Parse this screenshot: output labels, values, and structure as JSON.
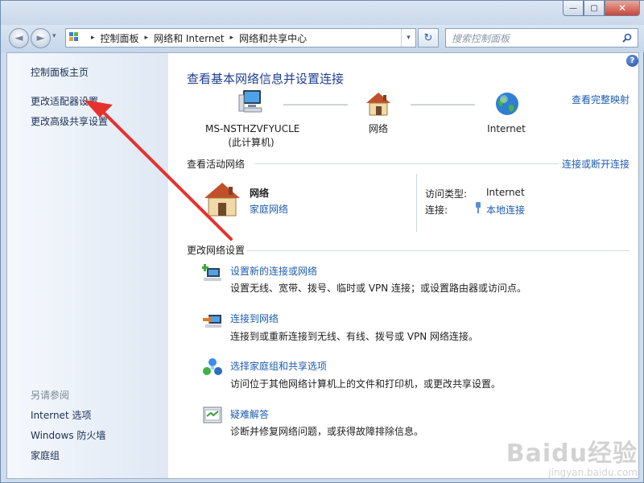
{
  "window": {
    "caption": {
      "minimize": "—",
      "maximize": "▢",
      "close": "✕"
    }
  },
  "navbar": {
    "back_glyph": "◄",
    "forward_glyph": "►",
    "address": {
      "segments": [
        "控制面板",
        "网络和 Internet",
        "网络和共享中心"
      ],
      "separator": "▸",
      "dropdown_glyph": "▾"
    },
    "refresh_glyph": "↻",
    "search_placeholder": "搜索控制面板"
  },
  "sidebar": {
    "links": [
      "控制面板主页",
      "更改适配器设置",
      "更改高级共享设置"
    ],
    "see_also_heading": "另请参阅",
    "see_also": [
      "Internet 选项",
      "Windows 防火墙",
      "家庭组"
    ]
  },
  "main": {
    "help_glyph": "?",
    "title": "查看基本网络信息并设置连接",
    "full_map_link": "查看完整映射",
    "map": {
      "computer_name": "MS-NSTHZVFYUCLE",
      "computer_sub": "(此计算机)",
      "network_label": "网络",
      "internet_label": "Internet"
    },
    "active": {
      "heading": "查看活动网络",
      "connect_link": "连接或断开连接",
      "network_name": "网络",
      "network_type": "家庭网络",
      "access_type_label": "访问类型:",
      "access_type_value": "Internet",
      "connections_label": "连接:",
      "connections_value": "本地连接"
    },
    "change": {
      "heading": "更改网络设置",
      "tasks": [
        {
          "icon": "new-connection-icon",
          "title": "设置新的连接或网络",
          "desc": "设置无线、宽带、拨号、临时或 VPN 连接；或设置路由器或访问点。"
        },
        {
          "icon": "connect-network-icon",
          "title": "连接到网络",
          "desc": "连接到或重新连接到无线、有线、拨号或 VPN 网络连接。"
        },
        {
          "icon": "homegroup-icon",
          "title": "选择家庭组和共享选项",
          "desc": "访问位于其他网络计算机上的文件和打印机，或更改共享设置。"
        },
        {
          "icon": "troubleshoot-icon",
          "title": "疑难解答",
          "desc": "诊断并修复网络问题，或获得故障排除信息。"
        }
      ]
    }
  },
  "watermark": {
    "logo": "Baidu经验",
    "url": "jingyan.baidu.com"
  },
  "colors": {
    "link": "#1d5cb0",
    "title": "#1f3f8f",
    "arrow": "#e5322d",
    "sidebar_text": "#1b2f55"
  }
}
